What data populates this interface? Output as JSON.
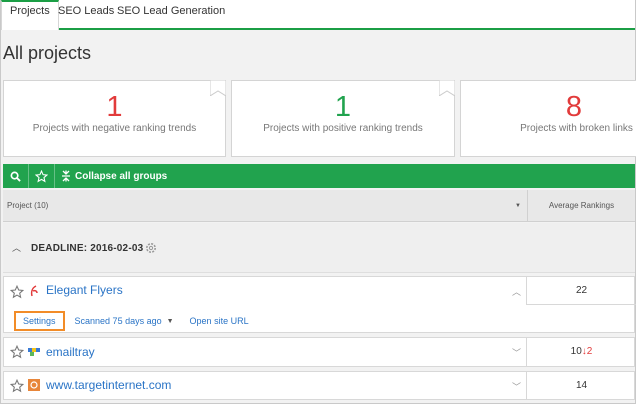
{
  "tabs": [
    {
      "label": "Projects",
      "active": true
    },
    {
      "label": "SEO Leads",
      "active": false
    },
    {
      "label": "SEO Lead Generation",
      "active": false
    }
  ],
  "page_title": "All projects",
  "cards": [
    {
      "value": "1",
      "label": "Projects with negative ranking trends",
      "color": "#e23b3b"
    },
    {
      "value": "1",
      "label": "Projects with positive ranking trends",
      "color": "#21a34e"
    },
    {
      "value": "8",
      "label": "Projects with broken links",
      "color": "#e23b3b"
    }
  ],
  "toolbar": {
    "search_icon": "search-icon",
    "star_icon": "star-outline-icon",
    "collapse_label": "Collapse all groups"
  },
  "table": {
    "project_header": "Project (10)",
    "avg_header": "Average Rankings"
  },
  "group": {
    "label": "DEADLINE: 2016-02-03"
  },
  "projects": [
    {
      "name": "Elegant Flyers",
      "favicon_color": "#e23b3b",
      "rank": "22",
      "expanded": true,
      "actions": {
        "settings": "Settings",
        "scanned": "Scanned 75 days ago",
        "open_url": "Open site URL"
      }
    },
    {
      "name": "emailtray",
      "favicon_color": "#3a7bd5",
      "rank": "10",
      "rank_change": "2",
      "expanded": false
    },
    {
      "name": "www.targetinternet.com",
      "favicon_color": "#e8863a",
      "rank": "14",
      "expanded": false
    }
  ],
  "colors": {
    "accent": "#21a34e",
    "link": "#2a74c6",
    "negative": "#e23b3b",
    "highlight": "#f28c28"
  }
}
